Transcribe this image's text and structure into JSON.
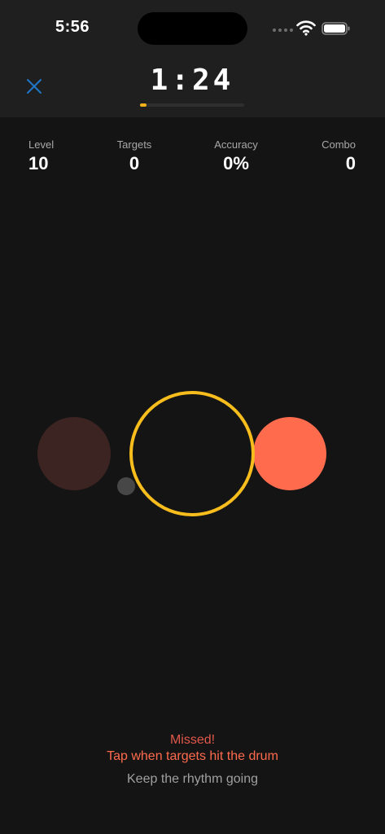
{
  "status_bar": {
    "time": "5:56"
  },
  "header": {
    "timer": "1:24",
    "close_icon": "close-icon",
    "progress": 0.06,
    "accent_color": "#f4b21a"
  },
  "stats": {
    "level": {
      "label": "Level",
      "value": "10"
    },
    "targets": {
      "label": "Targets",
      "value": "0"
    },
    "accuracy": {
      "label": "Accuracy",
      "value": "0%"
    },
    "combo": {
      "label": "Combo",
      "value": "0"
    }
  },
  "field": {
    "drum_color": "#f7bd1d",
    "target_color": "#ff6b4d",
    "faded_target_color": "#3c2422"
  },
  "feedback": {
    "result": "Missed!",
    "instruction": "Tap when targets hit the drum",
    "hint": "Keep the rhythm going"
  }
}
